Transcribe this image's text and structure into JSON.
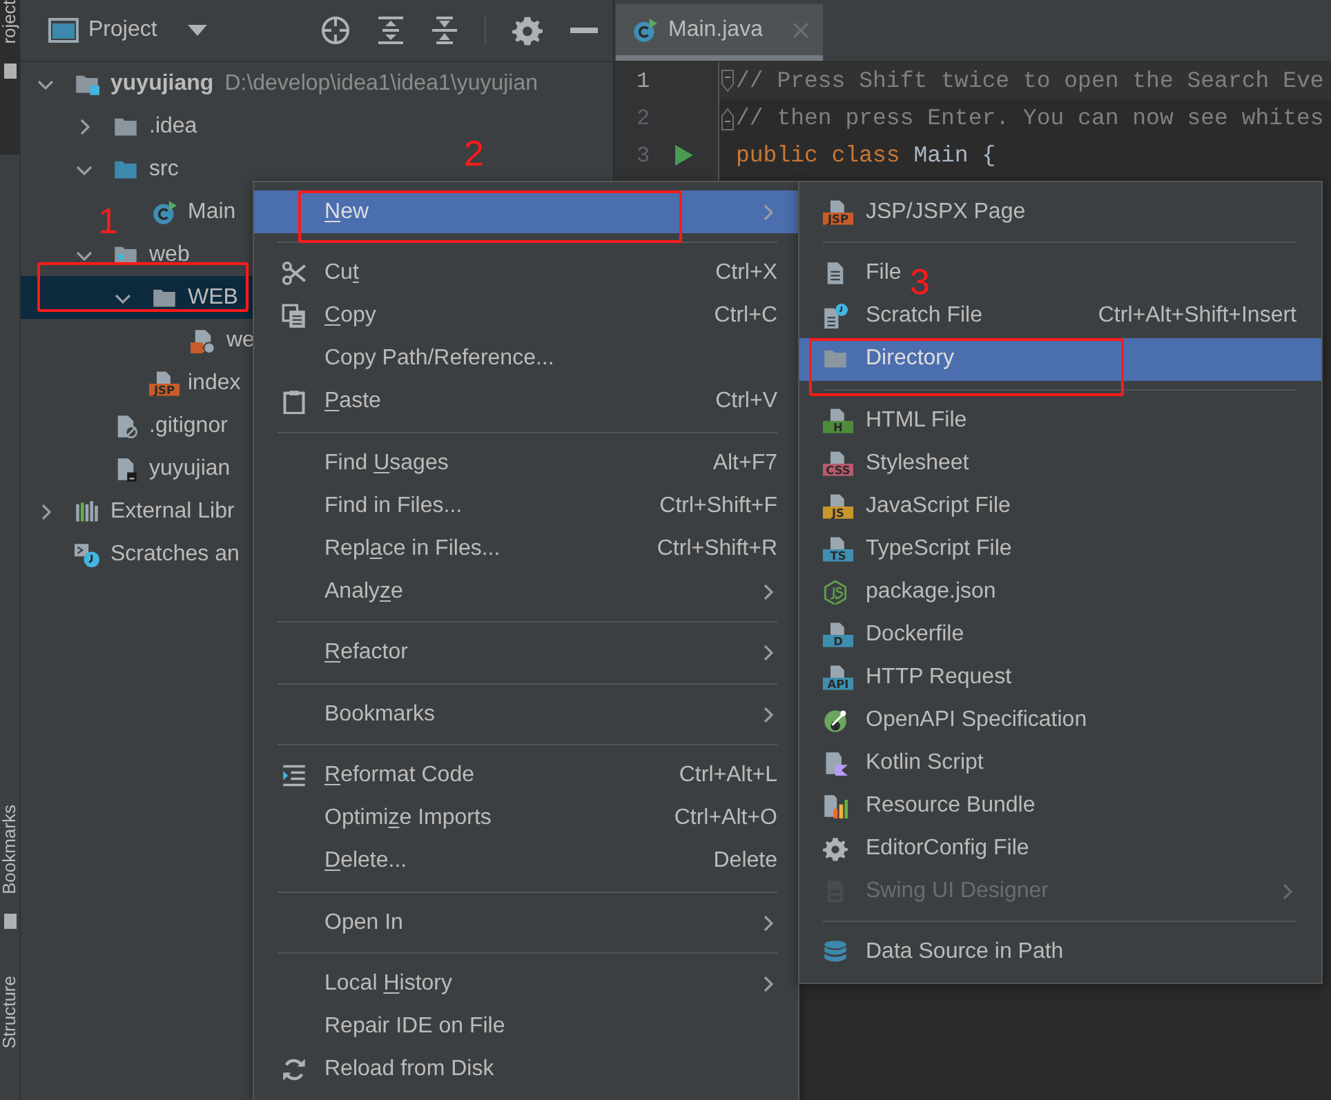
{
  "left_strip": {
    "tabs": [
      {
        "label": "roject",
        "selected": true
      },
      {
        "label": "Bookmarks",
        "selected": false
      },
      {
        "label": "Structure",
        "selected": false
      }
    ]
  },
  "project_panel": {
    "title": "Project",
    "tree": [
      {
        "kind": "module",
        "label": "yuyujiang",
        "hint": "D:\\develop\\idea1\\idea1\\yuyujian",
        "expanded": true,
        "selected": false,
        "children": [
          {
            "kind": "folder",
            "label": ".idea",
            "expanded": false,
            "selected": false
          },
          {
            "kind": "source-folder",
            "label": "src",
            "expanded": true,
            "selected": false,
            "children": [
              {
                "kind": "class",
                "label": "Main",
                "selected": false
              }
            ]
          },
          {
            "kind": "web-folder",
            "label": "web",
            "expanded": true,
            "selected": false,
            "children": [
              {
                "kind": "folder",
                "label": "WEB",
                "expanded": true,
                "selected": true,
                "children": [
                  {
                    "kind": "web-xml",
                    "label": "we",
                    "selected": false
                  }
                ]
              },
              {
                "kind": "badge-file",
                "label": "index",
                "badge": "JSP",
                "color": "#c75c29",
                "selected": false
              }
            ]
          },
          {
            "kind": "ignored-file",
            "label": ".gitignor",
            "selected": false
          },
          {
            "kind": "module-file",
            "label": "yuyujian",
            "selected": false
          }
        ]
      },
      {
        "kind": "libraries",
        "label": "External Libr",
        "expanded": false,
        "selected": false
      },
      {
        "kind": "scratches",
        "label": "Scratches an",
        "selected": false
      }
    ]
  },
  "editor": {
    "tabs": [
      {
        "label": "Main.java",
        "selected": true
      }
    ],
    "lines": [
      {
        "kind": "fold-start",
        "number": "1",
        "current": true,
        "run": false,
        "tokens": [
          {
            "kind": "comment",
            "text": "// Press Shift twice to open the Search Eve"
          }
        ]
      },
      {
        "kind": "fold-end",
        "number": "2",
        "current": false,
        "run": false,
        "tokens": [
          {
            "kind": "comment",
            "text": "// then press Enter. You can now see whites"
          }
        ]
      },
      {
        "kind": "plain",
        "number": "3",
        "current": false,
        "run": true,
        "tokens": [
          {
            "kind": "keyword",
            "text": "public class"
          },
          {
            "kind": "plain",
            "text": " Main {"
          }
        ]
      }
    ]
  },
  "context_menu": {
    "items": [
      {
        "kind": "plain",
        "mnemonic": {
          "key": "N",
          "after": "ew"
        },
        "submenu": true,
        "selected": true,
        "disabled": false
      },
      {
        "kind": "separator"
      },
      {
        "kind": "scissors",
        "mnemonic": {
          "before": "Cu",
          "key": "t"
        },
        "shortcut": "Ctrl+X",
        "submenu": false,
        "selected": false,
        "disabled": false
      },
      {
        "kind": "copy",
        "mnemonic": {
          "key": "C",
          "after": "opy"
        },
        "shortcut": "Ctrl+C",
        "submenu": false,
        "selected": false,
        "disabled": false
      },
      {
        "kind": "plain",
        "label": "Copy Path/Reference...",
        "submenu": false,
        "selected": false,
        "disabled": false
      },
      {
        "kind": "paste",
        "mnemonic": {
          "key": "P",
          "after": "aste"
        },
        "shortcut": "Ctrl+V",
        "submenu": false,
        "selected": false,
        "disabled": false
      },
      {
        "kind": "separator"
      },
      {
        "kind": "plain",
        "mnemonic": {
          "before": "Find ",
          "key": "U",
          "after": "sages"
        },
        "shortcut": "Alt+F7",
        "submenu": false,
        "selected": false,
        "disabled": false
      },
      {
        "kind": "plain",
        "label": "Find in Files...",
        "shortcut": "Ctrl+Shift+F",
        "submenu": false,
        "selected": false,
        "disabled": false
      },
      {
        "kind": "plain",
        "mnemonic": {
          "before": "Repl",
          "key": "a",
          "after": "ce in Files..."
        },
        "shortcut": "Ctrl+Shift+R",
        "submenu": false,
        "selected": false,
        "disabled": false
      },
      {
        "kind": "plain",
        "mnemonic": {
          "before": "Analy",
          "key": "z",
          "after": "e"
        },
        "submenu": true,
        "selected": false,
        "disabled": false
      },
      {
        "kind": "separator"
      },
      {
        "kind": "plain",
        "mnemonic": {
          "key": "R",
          "after": "efactor"
        },
        "submenu": true,
        "selected": false,
        "disabled": false
      },
      {
        "kind": "separator"
      },
      {
        "kind": "plain",
        "label": "Bookmarks",
        "submenu": true,
        "selected": false,
        "disabled": false
      },
      {
        "kind": "separator"
      },
      {
        "kind": "reformat",
        "mnemonic": {
          "key": "R",
          "after": "eformat Code"
        },
        "shortcut": "Ctrl+Alt+L",
        "submenu": false,
        "selected": false,
        "disabled": false
      },
      {
        "kind": "plain",
        "mnemonic": {
          "before": "Optimi",
          "key": "z",
          "after": "e Imports"
        },
        "shortcut": "Ctrl+Alt+O",
        "submenu": false,
        "selected": false,
        "disabled": false
      },
      {
        "kind": "plain",
        "mnemonic": {
          "key": "D",
          "after": "elete..."
        },
        "shortcut": "Delete",
        "submenu": false,
        "selected": false,
        "disabled": false
      },
      {
        "kind": "separator"
      },
      {
        "kind": "plain",
        "label": "Open In",
        "submenu": true,
        "selected": false,
        "disabled": false
      },
      {
        "kind": "separator"
      },
      {
        "kind": "plain",
        "mnemonic": {
          "before": "Local ",
          "key": "H",
          "after": "istory"
        },
        "submenu": true,
        "selected": false,
        "disabled": false
      },
      {
        "kind": "plain",
        "label": "Repair IDE on File",
        "submenu": false,
        "selected": false,
        "disabled": false
      },
      {
        "kind": "reload",
        "label": "Reload from Disk",
        "submenu": false,
        "selected": false,
        "disabled": false
      }
    ]
  },
  "new_submenu": {
    "items": [
      {
        "kind": "badge-file",
        "label": "JSP/JSPX Page",
        "badge": "JSP",
        "color": "#c75c29",
        "submenu": false,
        "selected": false,
        "disabled": false
      },
      {
        "kind": "separator"
      },
      {
        "kind": "file",
        "label": "File",
        "submenu": false,
        "selected": false,
        "disabled": false
      },
      {
        "kind": "scratch-file",
        "label": "Scratch File",
        "shortcut": "Ctrl+Alt+Shift+Insert",
        "submenu": false,
        "selected": false,
        "disabled": false
      },
      {
        "kind": "folder",
        "label": "Directory",
        "submenu": false,
        "selected": true,
        "disabled": false
      },
      {
        "kind": "separator"
      },
      {
        "kind": "badge-file",
        "label": "HTML File",
        "badge": "H",
        "color": "#4d8c3b",
        "submenu": false,
        "selected": false,
        "disabled": false
      },
      {
        "kind": "badge-file",
        "label": "Stylesheet",
        "badge": "CSS",
        "color": "#b85a6e",
        "submenu": false,
        "selected": false,
        "disabled": false
      },
      {
        "kind": "badge-file",
        "label": "JavaScript File",
        "badge": "JS",
        "color": "#c9962b",
        "submenu": false,
        "selected": false,
        "disabled": false
      },
      {
        "kind": "badge-file",
        "label": "TypeScript File",
        "badge": "TS",
        "color": "#3e8fb0",
        "submenu": false,
        "selected": false,
        "disabled": false
      },
      {
        "kind": "hexagon",
        "label": "package.json",
        "submenu": false,
        "selected": false,
        "disabled": false
      },
      {
        "kind": "badge-file",
        "label": "Dockerfile",
        "badge": "D",
        "color": "#3e8fb0",
        "submenu": false,
        "selected": false,
        "disabled": false
      },
      {
        "kind": "badge-file",
        "label": "HTTP Request",
        "badge": "API",
        "color": "#3e8fb0",
        "submenu": false,
        "selected": false,
        "disabled": false
      },
      {
        "kind": "openapi",
        "label": "OpenAPI Specification",
        "submenu": false,
        "selected": false,
        "disabled": false
      },
      {
        "kind": "kotlin",
        "label": "Kotlin Script",
        "submenu": false,
        "selected": false,
        "disabled": false
      },
      {
        "kind": "bundle",
        "label": "Resource Bundle",
        "submenu": false,
        "selected": false,
        "disabled": false
      },
      {
        "kind": "gear",
        "label": "EditorConfig File",
        "submenu": false,
        "selected": false,
        "disabled": false
      },
      {
        "kind": "form",
        "label": "Swing UI Designer",
        "submenu": true,
        "selected": false,
        "disabled": true
      },
      {
        "kind": "separator"
      },
      {
        "kind": "database",
        "label": "Data Source in Path",
        "submenu": false,
        "selected": false,
        "disabled": false
      }
    ]
  },
  "annotations": [
    {
      "label": "1"
    },
    {
      "label": "2"
    },
    {
      "label": "3"
    }
  ]
}
